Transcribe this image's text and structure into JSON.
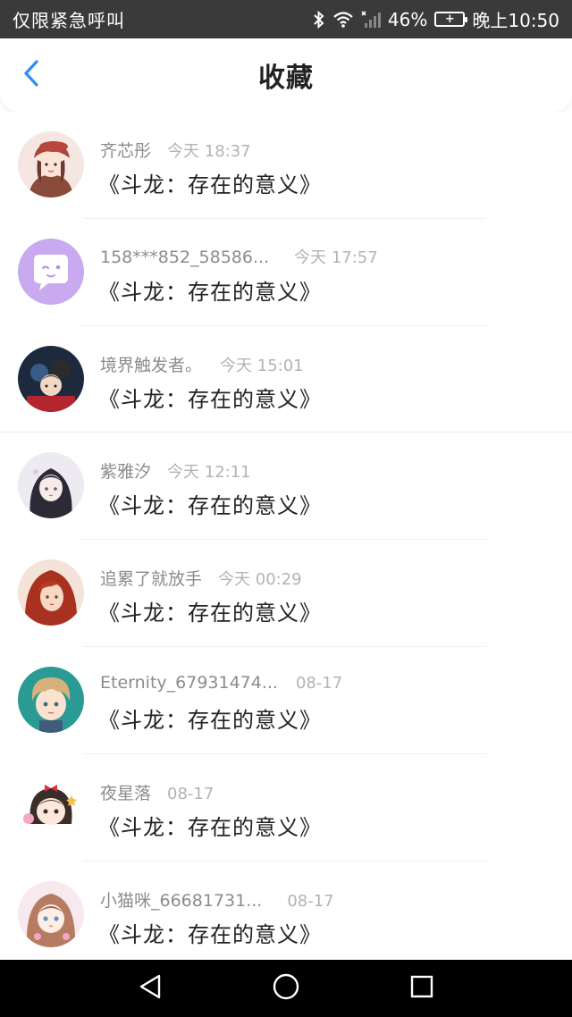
{
  "status_bar": {
    "carrier_text": "仅限紧急呼叫",
    "battery_percent": "46%",
    "time": "晚上10:50",
    "icons": [
      "bluetooth-icon",
      "wifi-icon",
      "signal-icon",
      "battery-icon"
    ]
  },
  "header": {
    "title": "收藏",
    "back_icon": "chevron-left-icon",
    "accent_color": "#2a8ff0"
  },
  "items": [
    {
      "user": "齐芯彤",
      "time": "今天 18:37",
      "message": "《斗龙：存在的意义》",
      "avatar": "avatar-girl-beret"
    },
    {
      "user": "158***852_58586...",
      "time": "今天 17:57",
      "message": "《斗龙：存在的意义》",
      "avatar": "avatar-purple-chat"
    },
    {
      "user": "境界触发者。",
      "time": "今天 15:01",
      "message": "《斗龙：存在的意义》",
      "avatar": "avatar-anime-group"
    },
    {
      "user": "紫雅汐",
      "time": "今天 12:11",
      "message": "《斗龙：存在的意义》",
      "avatar": "avatar-dark-hair-girl"
    },
    {
      "user": "追累了就放手",
      "time": "今天 00:29",
      "message": "《斗龙：存在的意义》",
      "avatar": "avatar-red-hair"
    },
    {
      "user": "Eternity_67931474...",
      "time": "08-17",
      "message": "《斗龙：存在的意义》",
      "avatar": "avatar-blond-boy"
    },
    {
      "user": "夜星落",
      "time": "08-17",
      "message": "《斗龙：存在的意义》",
      "avatar": "avatar-chibi-bow"
    },
    {
      "user": "小猫咪_66681731...",
      "time": "08-17",
      "message": "《斗龙：存在的意义》",
      "avatar": "avatar-pink-girl"
    }
  ],
  "nav_bar": {
    "back_icon": "triangle-back-icon",
    "home_icon": "circle-home-icon",
    "recents_icon": "square-recents-icon"
  }
}
